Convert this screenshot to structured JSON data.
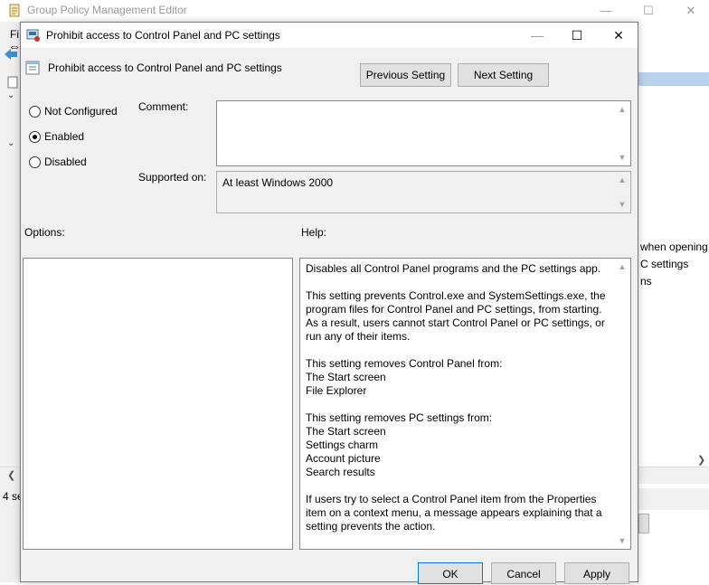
{
  "background_window": {
    "title": "Group Policy Management Editor",
    "menu_partial": "Fi",
    "status_partial": "4 se",
    "right_items": [
      "when opening C",
      "C settings",
      "ns"
    ]
  },
  "dialog": {
    "title": "Prohibit access to Control Panel and PC settings",
    "setting_name": "Prohibit access to Control Panel and PC settings",
    "previous_label": "Previous Setting",
    "next_label": "Next Setting",
    "radios": {
      "not_configured": "Not Configured",
      "enabled": "Enabled",
      "disabled": "Disabled",
      "selected": "enabled"
    },
    "comment_label": "Comment:",
    "comment_value": "",
    "supported_label": "Supported on:",
    "supported_value": "At least Windows 2000",
    "options_label": "Options:",
    "help_label": "Help:",
    "help_text": "Disables all Control Panel programs and the PC settings app.\n\nThis setting prevents Control.exe and SystemSettings.exe, the program files for Control Panel and PC settings, from starting. As a result, users cannot start Control Panel or PC settings, or run any of their items.\n\nThis setting removes Control Panel from:\nThe Start screen\nFile Explorer\n\nThis setting removes PC settings from:\nThe Start screen\nSettings charm\nAccount picture\nSearch results\n\nIf users try to select a Control Panel item from the Properties item on a context menu, a message appears explaining that a setting prevents the action.",
    "ok_label": "OK",
    "cancel_label": "Cancel",
    "apply_label": "Apply"
  },
  "icons": {
    "app": "policy-icon",
    "dialog": "policy-setting-icon",
    "minimize": "minimize-icon",
    "maximize": "maximize-icon",
    "close": "close-icon"
  },
  "colors": {
    "accent": "#0078d7",
    "dialog_bg": "#f0f0f0",
    "selection_header": "#b9d1ea"
  }
}
